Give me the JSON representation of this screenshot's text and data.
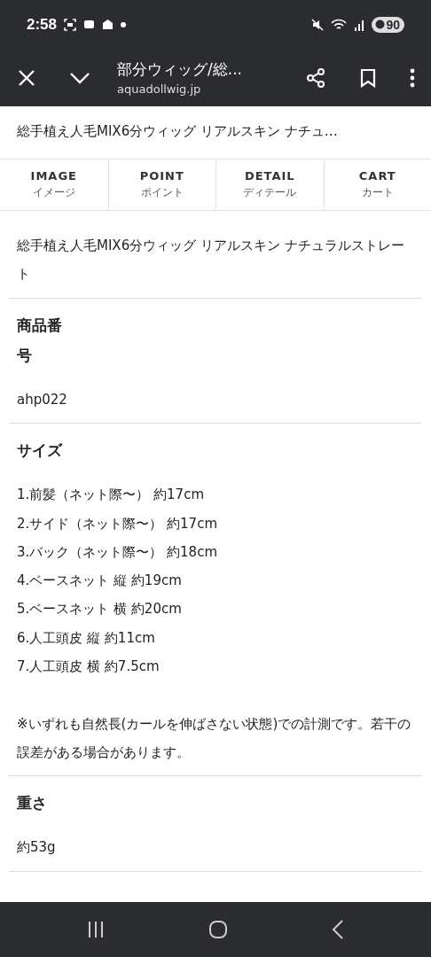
{
  "status_bar": {
    "time": "2:58",
    "battery": "90"
  },
  "toolbar": {
    "title": "部分ウィッグ/総...",
    "url": "aquadollwig.jp"
  },
  "page_title": "総手植え人毛MIX6分ウィッグ リアルスキン ナチュ…",
  "tabs": [
    {
      "label": "IMAGE",
      "sublabel": "イメージ"
    },
    {
      "label": "POINT",
      "sublabel": "ポイント"
    },
    {
      "label": "DETAIL",
      "sublabel": "ディテール"
    },
    {
      "label": "CART",
      "sublabel": "カート"
    }
  ],
  "product_name": "総手植え人毛MIX6分ウィッグ リアルスキン ナチュラルストレート",
  "specs": [
    {
      "label": "商品番号",
      "lines": [
        "ahp022"
      ]
    },
    {
      "label": "サイズ",
      "lines": [
        "1.前髪（ネット際〜） 約17cm",
        "2.サイド（ネット際〜） 約17cm",
        "3.バック（ネット際〜） 約18cm",
        "4.ベースネット 縦 約19cm",
        "5.ベースネット 横 約20cm",
        "6.人工頭皮 縦 約11cm",
        "7.人工頭皮 横 約7.5cm"
      ],
      "note": "※いずれも自然長(カールを伸ばさない状態)での計測です。若干の誤差がある場合があります。"
    },
    {
      "label": "重さ",
      "lines": [
        "約53g"
      ]
    }
  ]
}
